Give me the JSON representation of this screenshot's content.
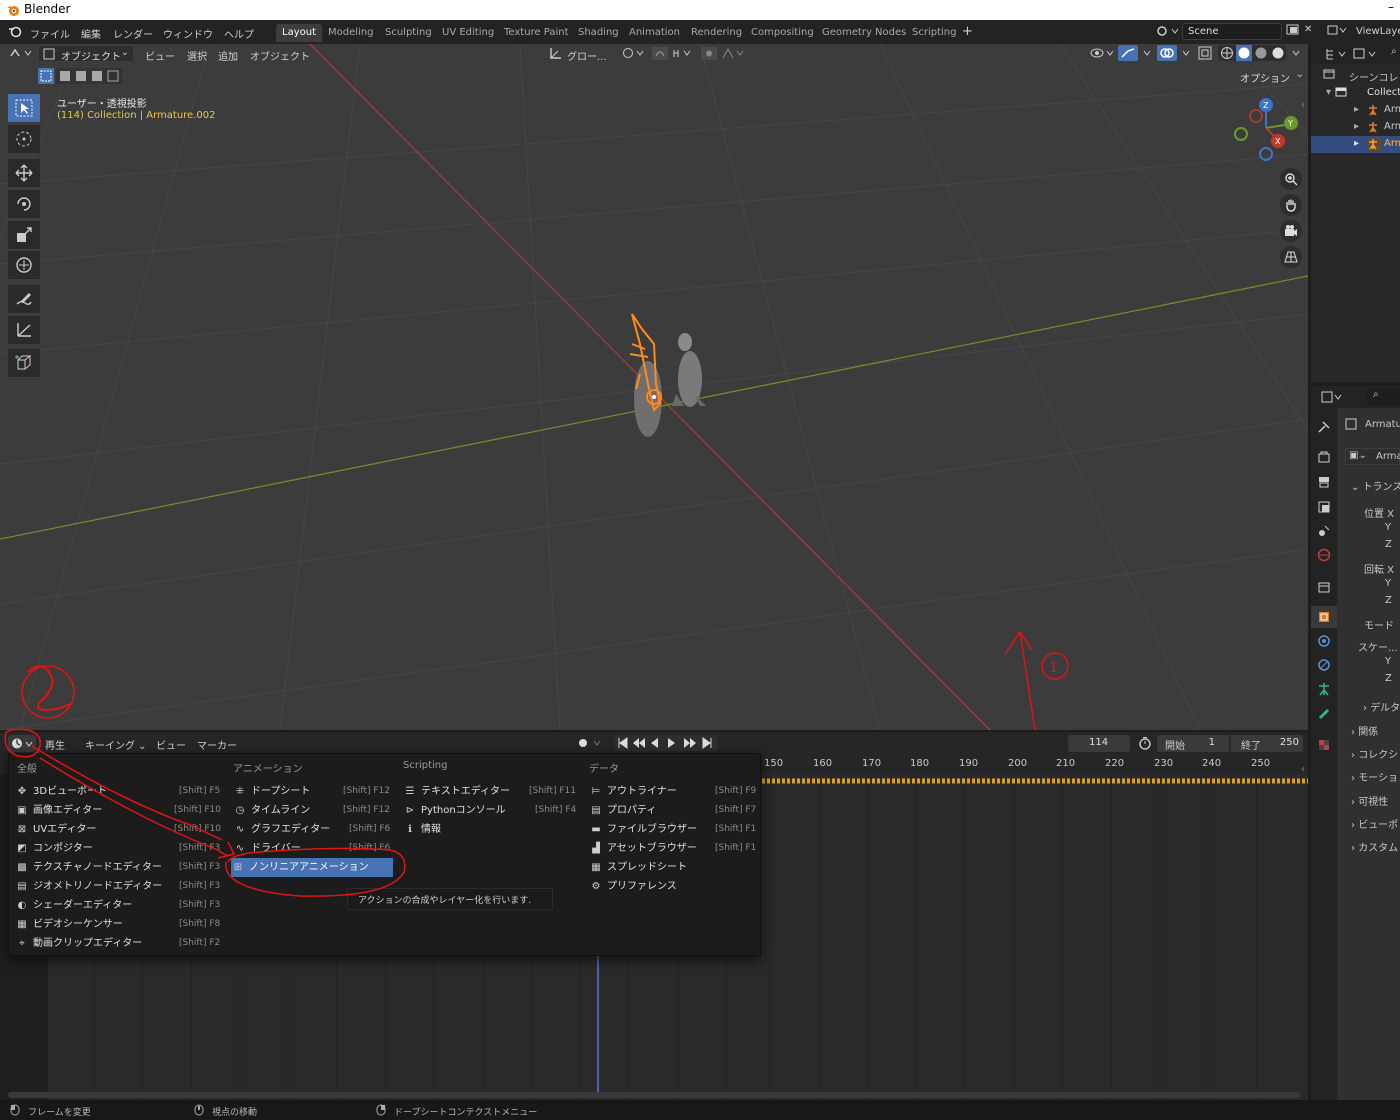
{
  "app": {
    "title": "Blender"
  },
  "topbar": {
    "menus": [
      "ファイル",
      "編集",
      "レンダー",
      "ウィンドウ",
      "ヘルプ"
    ],
    "workspaces": [
      "Layout",
      "Modeling",
      "Sculpting",
      "UV Editing",
      "Texture Paint",
      "Shading",
      "Animation",
      "Rendering",
      "Compositing",
      "Geometry Nodes",
      "Scripting"
    ],
    "active_workspace": "Layout",
    "add_workspace": "+",
    "scene": "Scene",
    "view_layer": "ViewLaye"
  },
  "viewport": {
    "mode": "オブジェクト",
    "menus": [
      "ビュー",
      "選択",
      "追加",
      "オブジェクト"
    ],
    "transform_orientation": "グロー...",
    "options": "オプション",
    "view_name": "ユーザー・透視投影",
    "context": "(114) Collection | Armature.002",
    "gizmo_labels": {
      "z": "Z",
      "y": "Y",
      "x": "X"
    },
    "annotation_1": "↑①"
  },
  "outliner": {
    "root": "シーンコレ",
    "collection": "Collecti",
    "items": [
      "Arm",
      "Arm",
      "Arm"
    ]
  },
  "properties": {
    "object_name": "Armatur",
    "data_name": "Arma",
    "section_transform": "トランス",
    "fields": [
      "位置 X",
      "Y",
      "Z",
      "回転 X",
      "Y",
      "Z",
      "モード",
      "スケー...",
      "Y",
      "Z"
    ],
    "delta": "デルタ",
    "sections": [
      "関係",
      "コレクシ",
      "モーショ",
      "可視性",
      "ビューポ",
      "カスタム"
    ]
  },
  "timeline": {
    "menus": [
      "再生",
      "キーイング",
      "ビュー",
      "マーカー"
    ],
    "current_frame": "114",
    "start_label": "開始",
    "start": "1",
    "end_label": "終了",
    "end": "250",
    "ruler": [
      "150",
      "160",
      "170",
      "180",
      "190",
      "200",
      "210",
      "220",
      "230",
      "240",
      "250"
    ],
    "annotation_2": "②"
  },
  "editor_menu": {
    "columns": [
      {
        "header": "全般",
        "items": [
          {
            "label": "3Dビューポート",
            "shortcut": "[Shift] F5",
            "icon": "view3d-icon"
          },
          {
            "label": "画像エディター",
            "shortcut": "[Shift] F10",
            "icon": "image-icon"
          },
          {
            "label": "UVエディター",
            "shortcut": "[Shift] F10",
            "icon": "uv-icon"
          },
          {
            "label": "コンポジター",
            "shortcut": "[Shift] F3",
            "icon": "compositor-icon"
          },
          {
            "label": "テクスチャノードエディター",
            "shortcut": "[Shift] F3",
            "icon": "texture-icon"
          },
          {
            "label": "ジオメトリノードエディター",
            "shortcut": "[Shift] F3",
            "icon": "geometry-icon"
          },
          {
            "label": "シェーダーエディター",
            "shortcut": "[Shift] F3",
            "icon": "shader-icon"
          },
          {
            "label": "ビデオシーケンサー",
            "shortcut": "[Shift] F8",
            "icon": "sequencer-icon"
          },
          {
            "label": "動画クリップエディター",
            "shortcut": "[Shift] F2",
            "icon": "clip-icon"
          }
        ]
      },
      {
        "header": "アニメーション",
        "items": [
          {
            "label": "ドープシート",
            "shortcut": "[Shift] F12",
            "icon": "dopesheet-icon"
          },
          {
            "label": "タイムライン",
            "shortcut": "[Shift] F12",
            "icon": "timeline-icon"
          },
          {
            "label": "グラフエディター",
            "shortcut": "[Shift] F6",
            "icon": "graph-icon"
          },
          {
            "label": "ドライバー",
            "shortcut": "[Shift] F6",
            "icon": "driver-icon"
          },
          {
            "label": "ノンリニアアニメーション",
            "shortcut": "",
            "icon": "nla-icon"
          }
        ]
      },
      {
        "header": "Scripting",
        "items": [
          {
            "label": "テキストエディター",
            "shortcut": "[Shift] F11",
            "icon": "text-icon"
          },
          {
            "label": "Pythonコンソール",
            "shortcut": "[Shift] F4",
            "icon": "console-icon"
          },
          {
            "label": "情報",
            "shortcut": "",
            "icon": "info-icon"
          }
        ]
      },
      {
        "header": "データ",
        "items": [
          {
            "label": "アウトライナー",
            "shortcut": "[Shift] F9",
            "icon": "outliner-icon"
          },
          {
            "label": "プロパティ",
            "shortcut": "[Shift] F7",
            "icon": "properties-icon"
          },
          {
            "label": "ファイルブラウザー",
            "shortcut": "[Shift] F1",
            "icon": "filebrowser-icon"
          },
          {
            "label": "アセットブラウザー",
            "shortcut": "[Shift] F1",
            "icon": "asset-icon"
          },
          {
            "label": "スプレッドシート",
            "shortcut": "",
            "icon": "spreadsheet-icon"
          },
          {
            "label": "プリファレンス",
            "shortcut": "",
            "icon": "preferences-icon"
          }
        ]
      }
    ],
    "tooltip": "アクションの合成やレイヤー化を行います."
  },
  "statusbar": {
    "items": [
      "フレームを変更",
      "視点の移動",
      "ドープシートコンテクストメニュー"
    ]
  },
  "colors": {
    "accent": "#4772b3",
    "x_axis": "#b13a3a",
    "y_axis": "#6b8f2a",
    "annotation": "#e01414",
    "selected": "#ff8a1e"
  }
}
